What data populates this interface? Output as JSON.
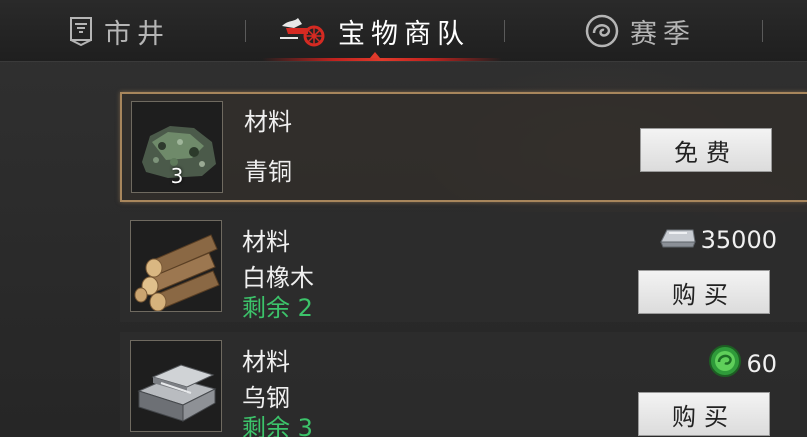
{
  "tabs": [
    {
      "label": "市井",
      "icon": "banner-icon",
      "active": false
    },
    {
      "label": "宝物商队",
      "icon": "chariot-icon",
      "active": true
    },
    {
      "label": "赛季",
      "icon": "swirl-emblem-icon",
      "active": false
    }
  ],
  "items": [
    {
      "category": "材料",
      "name": "青铜",
      "count": "3",
      "button": "免费",
      "selected": true,
      "thumb_icon": "bronze-ore-icon"
    },
    {
      "category": "材料",
      "name": "白橡木",
      "remain": "剩余 2",
      "price": "35000",
      "currency_icon": "silver-ingot-icon",
      "button": "购买",
      "thumb_icon": "oak-logs-icon"
    },
    {
      "category": "材料",
      "name": "乌钢",
      "remain": "剩余 3",
      "price": "60",
      "currency_icon": "jade-coin-icon",
      "button": "购买",
      "thumb_icon": "steel-ingots-icon"
    }
  ],
  "colors": {
    "active_underline": "#e03a2b",
    "remain_text": "#3cc36a",
    "selected_border": "#a8865c"
  }
}
